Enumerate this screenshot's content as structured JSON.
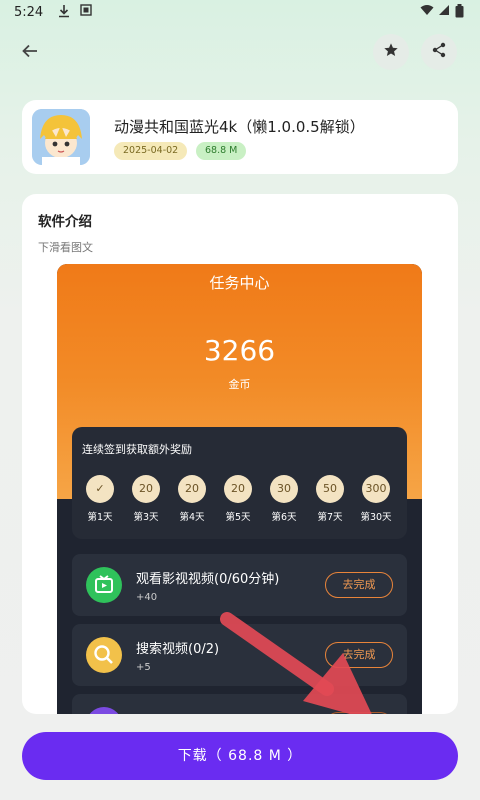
{
  "status_bar": {
    "time": "5:24",
    "left_icons": [
      "download-icon",
      "image-icon"
    ],
    "right_icons": [
      "wifi-icon",
      "signal-icon",
      "battery-icon"
    ]
  },
  "top_bar": {
    "back_icon": "arrow-left-icon",
    "favorite_icon": "star-icon",
    "share_icon": "share-icon"
  },
  "app": {
    "title": "动漫共和国蓝光4k（懒1.0.0.5解锁）",
    "date": "2025-04-02",
    "size": "68.8 M",
    "icon": "anime-character-icon"
  },
  "intro": {
    "title": "软件介绍",
    "hint": "下滑看图文",
    "screenshot": {
      "title": "任务中心",
      "coins": "3266",
      "coins_label": "金币",
      "checkin_title": "连续签到获取额外奖励",
      "days": [
        {
          "reward": "✓",
          "label": "第1天"
        },
        {
          "reward": "20",
          "label": "第3天"
        },
        {
          "reward": "20",
          "label": "第4天"
        },
        {
          "reward": "20",
          "label": "第5天"
        },
        {
          "reward": "30",
          "label": "第6天"
        },
        {
          "reward": "50",
          "label": "第7天"
        },
        {
          "reward": "300",
          "label": "第30天"
        }
      ],
      "tasks": [
        {
          "title": "观看影视视频(0/60分钟)",
          "reward": "+40",
          "button": "去完成",
          "icon": "tv-icon",
          "color": "#2fc25b"
        },
        {
          "title": "搜索视频(0/2)",
          "reward": "+5",
          "button": "去完成",
          "icon": "search-icon",
          "color": "#f2c14a"
        }
      ]
    }
  },
  "download": {
    "label": "下载（ 68.8 M ）"
  },
  "colors": {
    "accent": "#6a2cf1",
    "orange": "#f07a18",
    "arrow": "#e24a55"
  }
}
